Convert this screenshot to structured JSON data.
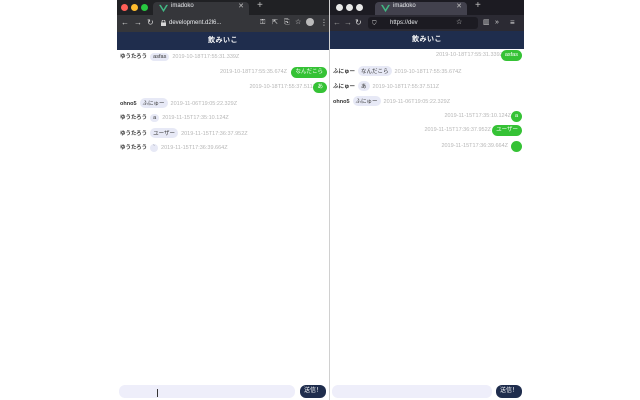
{
  "app": {
    "tab_title": "imadoko",
    "header_title": "飲みいこ",
    "send_label": "送信！"
  },
  "left_window": {
    "url": "development.d2l6...",
    "messages": [
      {
        "side": "left",
        "name": "ゆうたろう",
        "text": "asfas",
        "ts": "2019-10-18T17:55:31.339Z"
      },
      {
        "side": "right",
        "text": "なんだこら",
        "ts": "2019-10-18T17:55:35.674Z"
      },
      {
        "side": "right",
        "text": "あ",
        "ts": "2019-10-18T17:55:37.511Z"
      },
      {
        "side": "left",
        "name": "ohno5",
        "text": "ふにゅー",
        "ts": "2019-11-06T19:05:22.329Z"
      },
      {
        "side": "left",
        "name": "ゆうたろう",
        "text": "a",
        "ts": "2019-11-15T17:35:10.124Z"
      },
      {
        "side": "left",
        "name": "ゆうたろう",
        "text": "ユーザー",
        "ts": "2019-11-15T17:36:37.952Z"
      },
      {
        "side": "left",
        "name": "ゆうたろう",
        "text": "`",
        "ts": "2019-11-15T17:36:39.664Z"
      }
    ]
  },
  "right_window": {
    "url": "https://dev",
    "messages": [
      {
        "side": "right",
        "text": "asfas",
        "ts": "2019-10-18T17:55:31.339Z"
      },
      {
        "side": "left",
        "name": "ふにゅー",
        "text": "なんだこら",
        "ts": "2019-10-18T17:55:35.674Z"
      },
      {
        "side": "left",
        "name": "ふにゅー",
        "text": "あ",
        "ts": "2019-10-18T17:55:37.511Z"
      },
      {
        "side": "left",
        "name": "ohno5",
        "text": "ふにゅー",
        "ts": "2019-11-06T19:05:22.329Z"
      },
      {
        "side": "right",
        "text": "a",
        "ts": "2019-11-15T17:35:10.124Z"
      },
      {
        "side": "right",
        "text": "ユーザー",
        "ts": "2019-11-15T17:36:37.952Z"
      },
      {
        "side": "right",
        "text": "",
        "ts": "2019-11-15T17:36:39.664Z"
      }
    ]
  },
  "colors": {
    "header_bg": "#1f2d4d",
    "my_bubble": "#35c235",
    "other_bubble": "#e7e9f6",
    "input_bg": "#eeeefa"
  }
}
